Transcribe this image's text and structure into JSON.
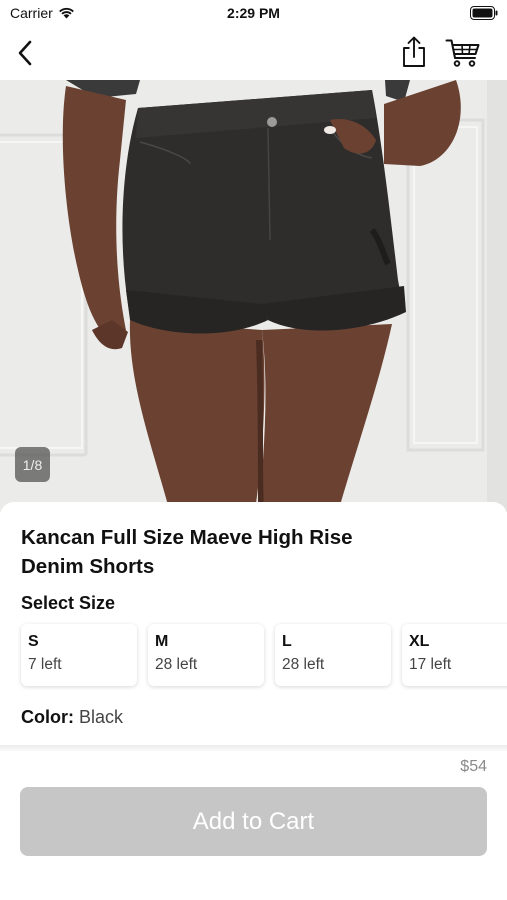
{
  "status_bar": {
    "carrier": "Carrier",
    "time": "2:29 PM"
  },
  "nav_bar": {
    "back_icon": "chevron-left-icon",
    "share_icon": "share-icon",
    "cart_icon": "cart-icon"
  },
  "gallery": {
    "counter": "1/8"
  },
  "product": {
    "title_line1": "Kancan Full Size Maeve High Rise",
    "title_line2": "Denim Shorts",
    "size_heading": "Select Size",
    "sizes": [
      {
        "label": "S",
        "stock": "7 left"
      },
      {
        "label": "M",
        "stock": "28 left"
      },
      {
        "label": "L",
        "stock": "28 left"
      },
      {
        "label": "XL",
        "stock": "17 left"
      }
    ],
    "color_label": "Color:",
    "color_value": "Black"
  },
  "footer": {
    "price": "$54",
    "add_to_cart_label": "Add to Cart",
    "button_color": "#c6c6c6"
  }
}
